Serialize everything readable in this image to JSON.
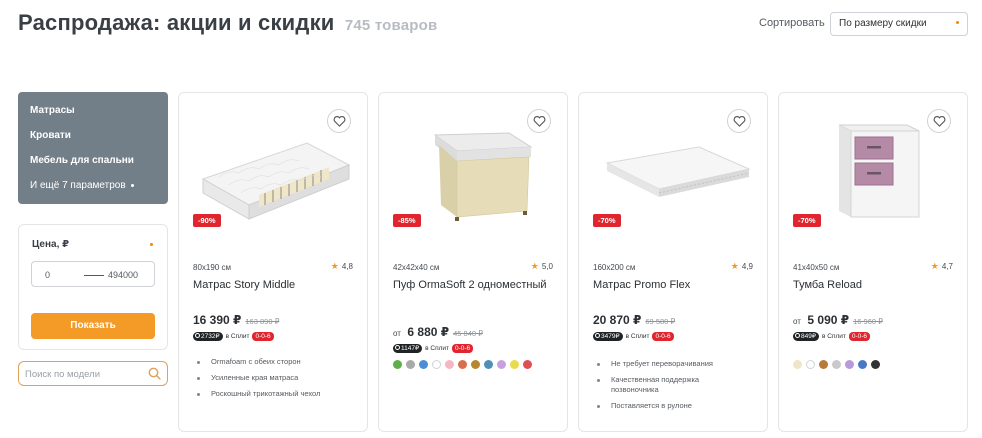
{
  "page": {
    "title": "Распродажа: акции и скидки",
    "count": "745 товаров"
  },
  "sort": {
    "label": "Сортировать",
    "value": "По размеру скидки"
  },
  "categories": [
    {
      "label": "Матрасы"
    },
    {
      "label": "Кровати"
    },
    {
      "label": "Мебель для спальни"
    },
    {
      "label": "И ещё 7 параметров"
    }
  ],
  "price_filter": {
    "label": "Цена, ₽",
    "from": "0",
    "to": "494000",
    "button": "Показать"
  },
  "model_search": {
    "placeholder": "Поиск по модели"
  },
  "products": [
    {
      "discount": "-90%",
      "size": "80x190 см",
      "rating": "4,8",
      "name": "Матрас Story Middle",
      "price_prefix": "",
      "price": "16 390 ₽",
      "old_price": "163 890 ₽",
      "split_amount": "2732₽",
      "split_text": "в Сплит",
      "split_pill": "0-0-6",
      "features": [
        "Ormafoam с обеих сторон",
        "Усиленные края матраса",
        "Роскошный трикотажный чехол"
      ],
      "swatches": []
    },
    {
      "discount": "-85%",
      "size": "42x42x40 см",
      "rating": "5,0",
      "name": "Пуф OrmaSoft 2 одноместный",
      "price_prefix": "от",
      "price": "6 880 ₽",
      "old_price": "45 840 ₽",
      "split_amount": "1147₽",
      "split_text": "в Сплит",
      "split_pill": "0-0-6",
      "features": [],
      "swatches": [
        "#5fae4e",
        "#a9a9a9",
        "#4a8fd6",
        "#ffffff",
        "#f4b8c2",
        "#d96e4e",
        "#b8862e",
        "#4f8fb8",
        "#c8a0e0",
        "#e8dc4a",
        "#e05050"
      ]
    },
    {
      "discount": "-70%",
      "size": "160x200 см",
      "rating": "4,9",
      "name": "Матрас Promo Flex",
      "price_prefix": "",
      "price": "20 870 ₽",
      "old_price": "69 580 ₽",
      "split_amount": "3479₽",
      "split_text": "в Сплит",
      "split_pill": "0-0-6",
      "features": [
        "Не требует переворачивания",
        "Качественная поддержка позвоночника",
        "Поставляется в рулоне"
      ],
      "swatches": []
    },
    {
      "discount": "-70%",
      "size": "41x40x50 см",
      "rating": "4,7",
      "name": "Тумба Reload",
      "price_prefix": "от",
      "price": "5 090 ₽",
      "old_price": "16 960 ₽",
      "split_amount": "849₽",
      "split_text": "в Сплит",
      "split_pill": "0-0-6",
      "features": [],
      "swatches": [
        "#efe6c8",
        "#ffffff",
        "#b87a3a",
        "#c9c9c9",
        "#b89ad8",
        "#4a78c8",
        "#333333"
      ]
    }
  ]
}
